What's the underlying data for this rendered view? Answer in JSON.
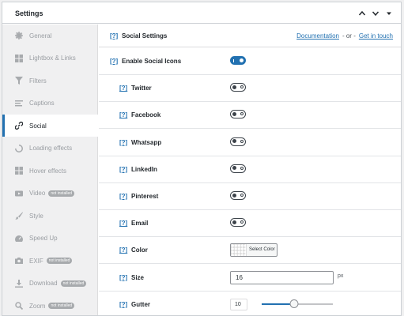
{
  "panel": {
    "title": "Settings"
  },
  "sidebar": {
    "items": [
      {
        "label": "General",
        "icon": "gear-icon",
        "active": false
      },
      {
        "label": "Lightbox & Links",
        "icon": "grid-icon",
        "active": false
      },
      {
        "label": "Filters",
        "icon": "filter-icon",
        "active": false
      },
      {
        "label": "Captions",
        "icon": "captions-icon",
        "active": false
      },
      {
        "label": "Social",
        "icon": "link-icon",
        "active": true
      },
      {
        "label": "Loading effects",
        "icon": "spinner-icon",
        "active": false
      },
      {
        "label": "Hover effects",
        "icon": "grid-icon",
        "active": false
      },
      {
        "label": "Video",
        "icon": "video-icon",
        "active": false,
        "badge": "not installed"
      },
      {
        "label": "Style",
        "icon": "brush-icon",
        "active": false
      },
      {
        "label": "Speed Up",
        "icon": "gauge-icon",
        "active": false
      },
      {
        "label": "EXIF",
        "icon": "camera-icon",
        "active": false,
        "badge": "not installed"
      },
      {
        "label": "Download",
        "icon": "download-icon",
        "active": false,
        "badge": "not installed"
      },
      {
        "label": "Zoom",
        "icon": "zoom-icon",
        "active": false,
        "badge": "not installed"
      }
    ]
  },
  "content": {
    "help": "[?]",
    "title": "Social Settings",
    "documentation_label": "Documentation",
    "or_label": "- or -",
    "get_in_touch_label": "Get in touch",
    "rows": [
      {
        "label": "Enable Social Icons",
        "type": "toggle",
        "on": true,
        "indent": false
      },
      {
        "label": "Twitter",
        "type": "toggle",
        "on": false,
        "indent": true
      },
      {
        "label": "Facebook",
        "type": "toggle",
        "on": false,
        "indent": true
      },
      {
        "label": "Whatsapp",
        "type": "toggle",
        "on": false,
        "indent": true
      },
      {
        "label": "LinkedIn",
        "type": "toggle",
        "on": false,
        "indent": true
      },
      {
        "label": "Pinterest",
        "type": "toggle",
        "on": false,
        "indent": true
      },
      {
        "label": "Email",
        "type": "toggle",
        "on": false,
        "indent": true
      },
      {
        "label": "Color",
        "type": "color",
        "button_label": "Select Color",
        "indent": true
      },
      {
        "label": "Size",
        "type": "number",
        "value": "16",
        "unit": "px",
        "indent": true
      },
      {
        "label": "Gutter",
        "type": "range",
        "value": "10",
        "fraction": 0.45,
        "indent": true
      }
    ]
  },
  "colors": {
    "accent": "#2271b1",
    "sidebar_bg": "#f0f0f1"
  }
}
